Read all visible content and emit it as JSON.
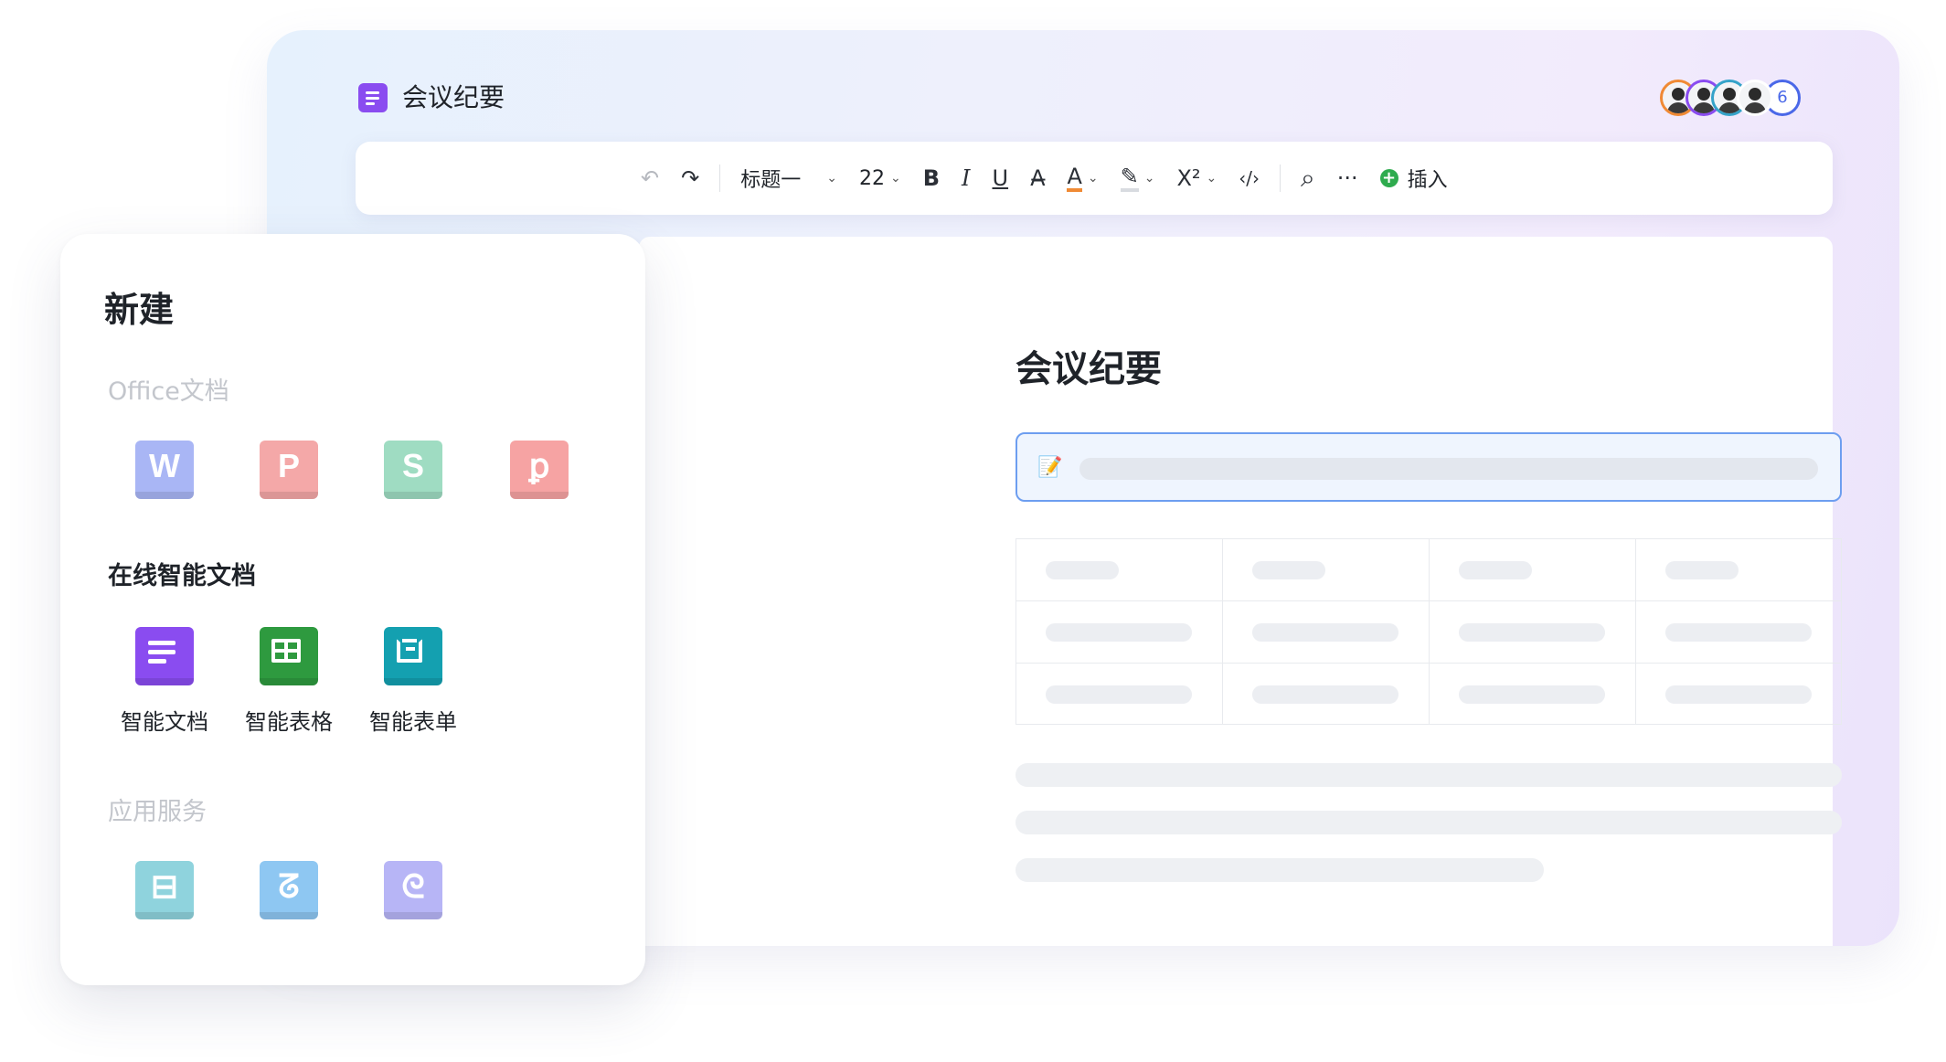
{
  "editor": {
    "header_title": "会议纪要",
    "collaborator_count": "6",
    "toolbar": {
      "undo_icon": "↶",
      "redo_icon": "↷",
      "heading_style": "标题一",
      "font_size": "22",
      "bold": "B",
      "italic": "I",
      "underline": "U",
      "strikethrough": "A̶",
      "font_color": "A",
      "highlight_icon": "✎",
      "superscript": "X²",
      "code_icon": "‹/›",
      "search_icon": "⌕",
      "more_icon": "···",
      "insert_label": "插入",
      "insert_icon": "+",
      "caret": "⌄"
    },
    "document": {
      "title": "会议纪要",
      "callout_icon": "📝"
    }
  },
  "new_panel": {
    "title": "新建",
    "sections": {
      "office": {
        "label": "Office文档",
        "items": [
          {
            "glyph": "W",
            "color": "#a9b6f5"
          },
          {
            "glyph": "P",
            "color": "#f4a8a8"
          },
          {
            "glyph": "S",
            "color": "#9fdcc2"
          },
          {
            "glyph": "ꝑ",
            "color": "#f6a3a3"
          }
        ]
      },
      "online": {
        "label": "在线智能文档",
        "items": [
          {
            "label": "智能文档",
            "color": "#8a4cf0"
          },
          {
            "label": "智能表格",
            "color": "#2e9a3f"
          },
          {
            "label": "智能表单",
            "color": "#14a0b0"
          }
        ]
      },
      "apps": {
        "label": "应用服务",
        "items": [
          {
            "glyph": "⊟",
            "color": "#8fd3dd"
          },
          {
            "glyph": "ᘔ",
            "color": "#8ec7f2"
          },
          {
            "glyph": "ᘓ",
            "color": "#b7b5f6"
          }
        ]
      }
    }
  }
}
